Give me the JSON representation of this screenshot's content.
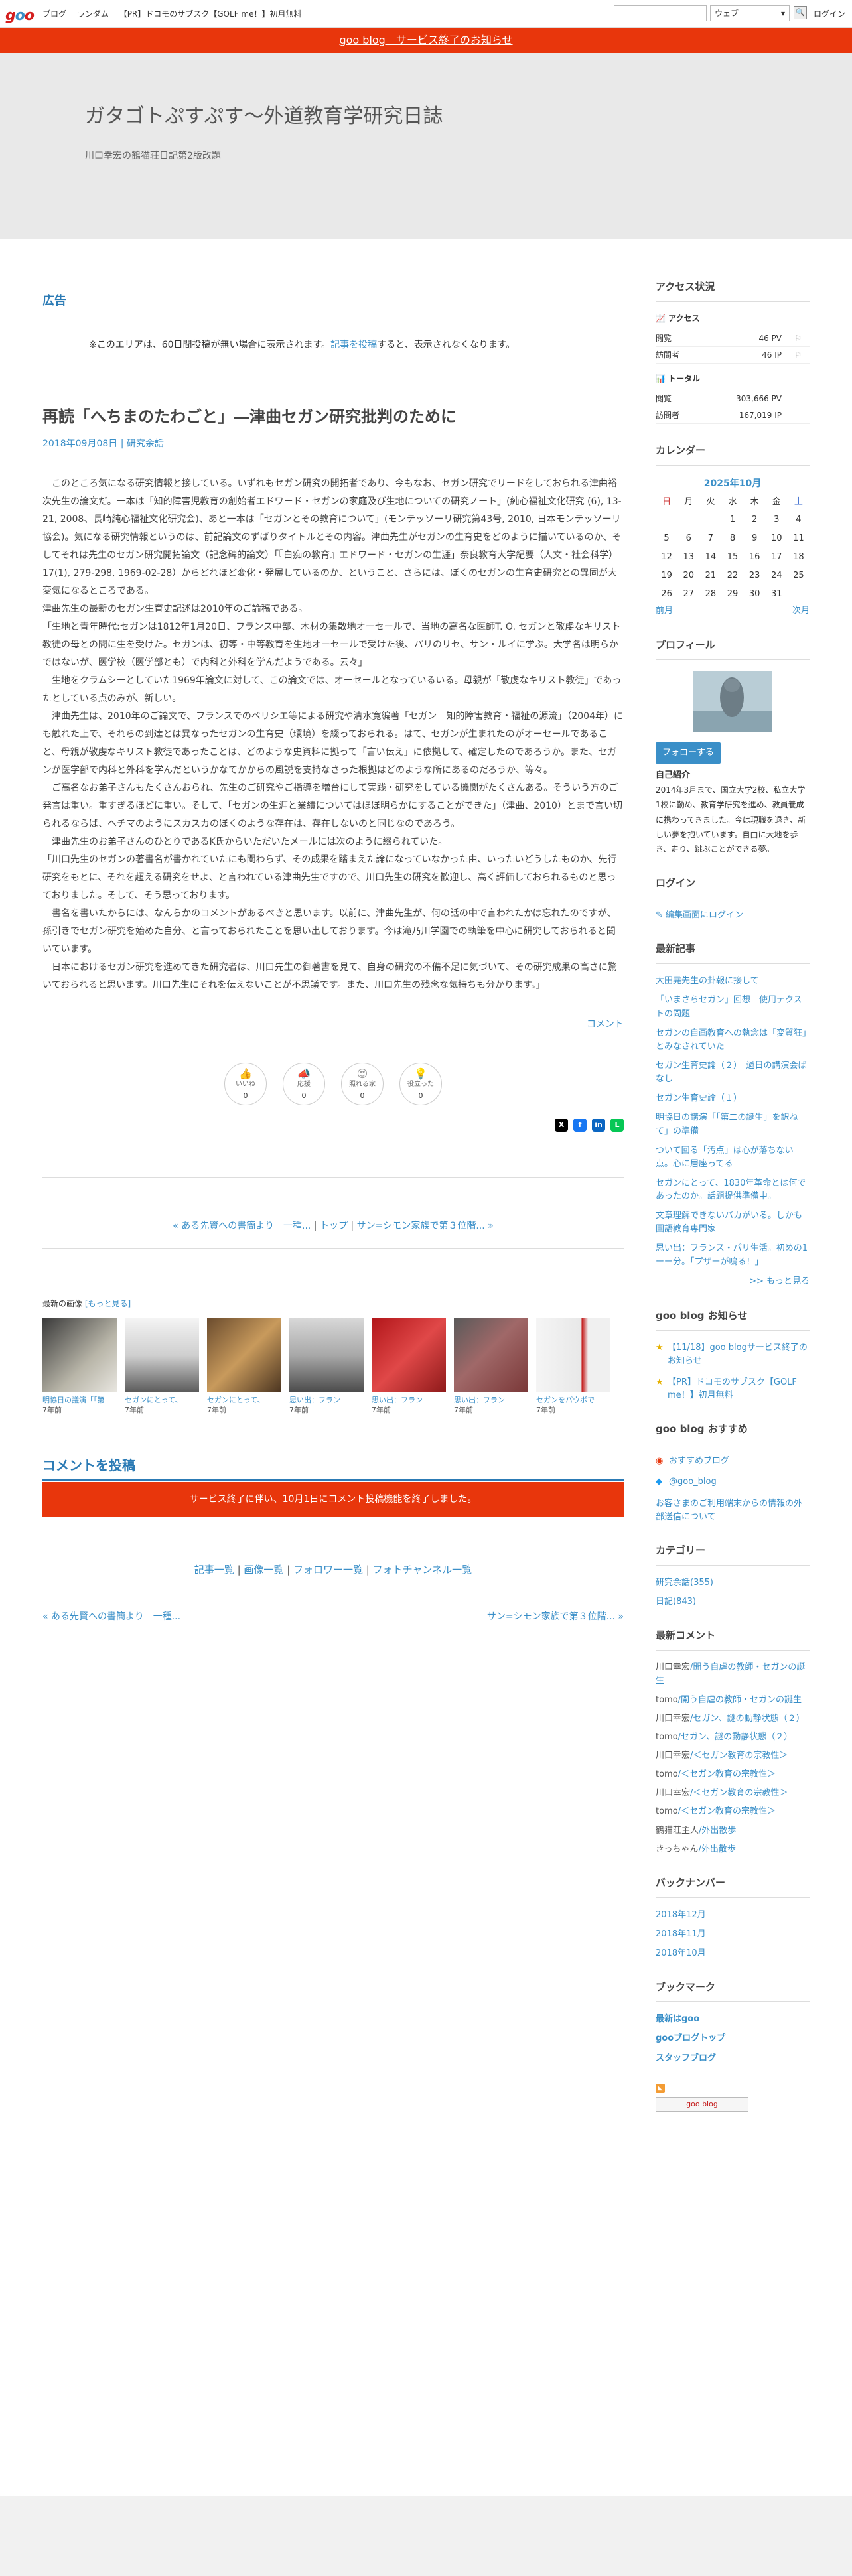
{
  "topbar": {
    "logo": "goo",
    "links": [
      "ブログ",
      "ランダム",
      "【PR】ドコモのサブスク【GOLF me！】初月無料"
    ],
    "search_scope": "ウェブ",
    "search_button": "🔍",
    "login": "ログイン"
  },
  "notice": "goo blog　サービス終了のお知らせ",
  "blog": {
    "title": "ガタゴトぷすぷす〜外道教育学研究日誌",
    "subtitle": "川口幸宏の鶴猫荘日記第2版改題"
  },
  "ad": {
    "title": "広告",
    "note_pre": "※このエリアは、60日間投稿が無い場合に表示されます。",
    "note_link": "記事を投稿",
    "note_post": "すると、表示されなくなります。"
  },
  "article": {
    "title": "再読「へちまのたわごと」―津曲セガン研究批判のために",
    "date": "2018年09月08日",
    "category": "研究余話",
    "paragraphs": [
      "　このところ気になる研究情報と接している。いずれもセガン研究の開拓者であり、今もなお、セガン研究でリードをしておられる津曲裕次先生の論文だ。一本は「知的障害児教育の創始者エドワード・セガンの家庭及び生地についての研究ノート」(純心福祉文化研究 (6), 13-21, 2008、長崎純心福祉文化研究会)、あと一本は「セガンとその教育について」(モンテッソーリ研究第43号, 2010, 日本モンテッソーリ協会)。気になる研究情報というのは、前記論文のずばりタイトルとその内容。津曲先生がセガンの生育史をどのように描いているのか、そしてそれは先生のセガン研究開拓論文（記念碑的論文）「『白痴の教育』エドワード・セガンの生涯」奈良教育大学紀要（人文・社会科学）17(1), 279-298, 1969-02-28）からどれほど変化・発展しているのか、ということ、さらには、ぼくのセガンの生育史研究との異同が大変気になるところである。",
      "津曲先生の最新のセガン生育史記述は2010年のご論稿である。",
      "「生地と青年時代:セガンは1812年1月20日、フランス中部、木材の集散地オーセールで、当地の高名な医師T. O. セガンと敬虔なキリスト教徒の母との間に生を受けた。セガンは、初等・中等教育を生地オーセールで受けた後、パリのリセ、サン・ルイに学ぶ。大学名は明らかではないが、医学校（医学部とも）で内科と外科を学んだようである。云々」",
      "　生地をクラムシーとしていた1969年論文に対して、この論文では、オーセールとなっているいる。母親が「敬虔なキリスト教徒」であったとしている点のみが、新しい。",
      "　津曲先生は、2010年のご論文で、フランスでのペリシエ等による研究や清水寛編著「セガン　知的障害教育・福祉の源流」（2004年）にも触れた上で、それらの到達とは異なったセガンの生育史（環境）を綴っておられる。はて、セガンが生まれたのがオーセールであること、母親が敬虔なキリスト教徒であったことは、どのような史資料に拠って「言い伝え」に依拠して、確定したのであろうか。また、セガンが医学部で内科と外科を学んだというかなてかからの風説を支持なさった根拠はどのような所にあるのだろうか、等々。",
      "　ご高名なお弟子さんもたくさんおられ、先生のご研究やご指導を増台にして実践・研究をしている機関がたくさんある。そういう方のご発言は重い。重すぎるほどに重い。そして、「セガンの生涯と業績についてはほぼ明らかにすることができた」（津曲、2010）とまで言い切られるならば、ヘチマのようにスカスカのぼくのような存在は、存在しないのと同じなのであろう。",
      "　津曲先生のお弟子さんのひとりであるK氏からいただいたメールには次のように綴られていた。",
      "「川口先生のセガンの著書名が書かれていたにも関わらず、その成果を踏まえた論になっていなかった由、いったいどうしたものか、先行研究をもとに、それを超える研究をせよ、と言われている津曲先生ですので、川口先生の研究を歓迎し、高く評価しておられるものと思っておりました。そして、そう思っております。",
      "　書名を書いたからには、なんらかのコメントがあるべきと思います。以前に、津曲先生が、何の話の中で言われたかは忘れたのですが、孫引きでセガン研究を始めた自分、と言っておられたことを思い出しております。今は滝乃川学園での執筆を中心に研究しておられると聞いています。",
      "　日本におけるセガン研究を進めてきた研究者は、川口先生の御著書を見て、自身の研究の不備不足に気づいて、その研究成果の高さに驚いておられると思います。川口先生にそれを伝えないことが不思議です。また、川口先生の残念な気持ちも分かります。」"
    ],
    "comment_link": "コメント",
    "reactions": [
      {
        "icon": "👍",
        "label": "いいね",
        "count": "0"
      },
      {
        "icon": "📣",
        "label": "応援",
        "count": "0"
      },
      {
        "icon": "😍",
        "label": "照れる家",
        "count": "0"
      },
      {
        "icon": "💡",
        "label": "役立った",
        "count": "0"
      }
    ],
    "share": [
      "X",
      "f",
      "in",
      "L"
    ]
  },
  "nav": {
    "prev": "« ある先賢への書簡より　一種...",
    "top": "トップ",
    "next": "サン=シモン家族で第３位階... »"
  },
  "recent_images": {
    "title": "最新の画像",
    "more": "[もっと見る]",
    "items": [
      {
        "caption": "明協日の議演「「第",
        "date": "7年前"
      },
      {
        "caption": "セガンにとって、",
        "date": "7年前"
      },
      {
        "caption": "セガンにとって、",
        "date": "7年前"
      },
      {
        "caption": "思い出：フラン",
        "date": "7年前"
      },
      {
        "caption": "思い出：フラン",
        "date": "7年前"
      },
      {
        "caption": "思い出：フラン",
        "date": "7年前"
      },
      {
        "caption": "セガンをパウボで",
        "date": "7年前"
      }
    ]
  },
  "post_comment": {
    "title": "コメントを投稿",
    "closed": "サービス終了に伴い、10月1日にコメント投稿機能を終了しました。"
  },
  "list_links": [
    "記事一覧",
    "画像一覧",
    "フォロワー一覧",
    "フォトチャンネル一覧"
  ],
  "prevnext": {
    "prev": "« ある先賢への書簡より　一種...",
    "next": "サン=シモン家族で第３位階... »"
  },
  "sidebar": {
    "access": {
      "title": "アクセス状況",
      "sub1": "アクセス",
      "rows1": [
        {
          "k": "閲覧",
          "v": "46 PV"
        },
        {
          "k": "訪問者",
          "v": "46 IP"
        }
      ],
      "sub2": "トータル",
      "rows2": [
        {
          "k": "閲覧",
          "v": "303,666 PV"
        },
        {
          "k": "訪問者",
          "v": "167,019 IP"
        }
      ]
    },
    "calendar": {
      "title": "カレンダー",
      "month": "2025年10月",
      "days": [
        "日",
        "月",
        "火",
        "水",
        "木",
        "金",
        "土"
      ],
      "weeks": [
        [
          "",
          "",
          "",
          "1",
          "2",
          "3",
          "4"
        ],
        [
          "5",
          "6",
          "7",
          "8",
          "9",
          "10",
          "11"
        ],
        [
          "12",
          "13",
          "14",
          "15",
          "16",
          "17",
          "18"
        ],
        [
          "19",
          "20",
          "21",
          "22",
          "23",
          "24",
          "25"
        ],
        [
          "26",
          "27",
          "28",
          "29",
          "30",
          "31",
          ""
        ]
      ],
      "prev": "前月",
      "next": "次月"
    },
    "profile": {
      "title": "プロフィール",
      "follow": "フォローする",
      "self_title": "自己紹介",
      "self_text": "2014年3月まで、国立大学2校、私立大学1校に勤め、教育学研究を進め、教員養成に携わってきました。今は現職を退き、新しい夢を抱いています。自由に大地を歩き、走り、跳ぶことができる夢。"
    },
    "login": {
      "title": "ログイン",
      "link": "編集画面にログイン"
    },
    "recent": {
      "title": "最新記事",
      "items": [
        "大田堯先生の卦報に接して",
        "「いまさらセガン」回想　使用テクストの問題",
        "セガンの自画教育への執念は「変質狂」とみなされていた",
        "セガン生育史論（２）　過日の講演会ばなし",
        "セガン生育史論（１）",
        "明協日の講演「「第二の誕生」を訳ねて」の準備",
        "ついて回る「汚点」は心が落ちない点。心に居座ってる",
        "セガンにとって、1830年革命とは何であったのか。話題提供準備中。",
        "文章理解できないバカがいる。しかも国語教育専門家",
        "思い出：フランス・パリ生活。初めの1ーー分。「プザーが鳴る！」"
      ],
      "more": ">> もっと見る"
    },
    "news": {
      "title": "goo blog お知らせ",
      "items": [
        "【11/18】goo blogサービス終了のお知らせ",
        "【PR】ドコモのサブスク【GOLF me！】初月無料"
      ]
    },
    "recommend": {
      "title": "goo blog おすすめ",
      "items": [
        "おすすめブログ",
        "@goo_blog"
      ],
      "note": "お客さまのご利用端末からの情報の外部送信について"
    },
    "category": {
      "title": "カテゴリー",
      "items": [
        "研究余話(355)",
        "日記(843)"
      ]
    },
    "comments": {
      "title": "最新コメント",
      "items": [
        {
          "who": "川口幸宏",
          "on": "/開う自虐の教師・セガンの誕生"
        },
        {
          "who": "tomo",
          "on": "/開う自虐の教師・セガンの誕生"
        },
        {
          "who": "川口幸宏",
          "on": "/セガン、謎の動静状態（２）"
        },
        {
          "who": "tomo",
          "on": "/セガン、謎の動静状態（２）"
        },
        {
          "who": "川口幸宏",
          "on": "/＜セガン教育の宗教性＞"
        },
        {
          "who": "tomo",
          "on": "/＜セガン教育の宗教性＞"
        },
        {
          "who": "川口幸宏",
          "on": "/＜セガン教育の宗教性＞"
        },
        {
          "who": "tomo",
          "on": "/＜セガン教育の宗教性＞"
        },
        {
          "who": "鶴猫荘主人",
          "on": "/外出散歩"
        },
        {
          "who": "きっちゃん",
          "on": "/外出散歩"
        }
      ]
    },
    "backnumber": {
      "title": "バックナンバー",
      "items": [
        "2018年12月",
        "2018年11月",
        "2018年10月"
      ]
    },
    "bookmark": {
      "title": "ブックマーク",
      "items": [
        "最新はgoo",
        "gooブログトップ",
        "スタッフブログ"
      ]
    },
    "footer_badge": "goo blog"
  },
  "colors": {
    "accent": "#3a8fc8",
    "notice": "#e8360c"
  }
}
